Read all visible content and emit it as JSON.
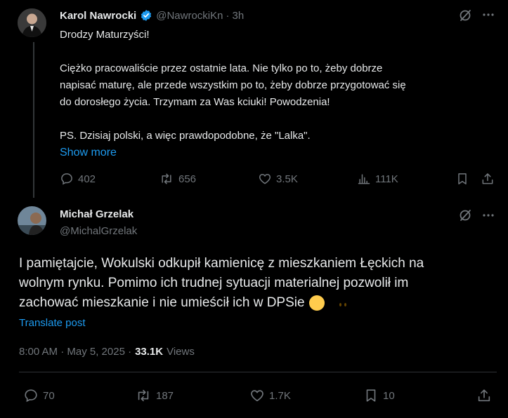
{
  "parent": {
    "author_name": "Karol Nawrocki",
    "handle": "@NawrockiKn",
    "separator": "·",
    "time": "3h",
    "lines": [
      "Drodzy Maturzyści!",
      "Ciężko pracowaliście przez ostatnie lata. Nie tylko po to, żeby dobrze",
      "napisać maturę, ale przede wszystkim po to, żeby dobrze przygotować się",
      "do dorosłego życia. Trzymam za Was kciuki! Powodzenia!",
      "PS. Dzisiaj polski, a więc prawdopodobne, że \"Lalka\"."
    ],
    "show_more": "Show more",
    "replies": "402",
    "reposts": "656",
    "likes": "3.5K",
    "views": "111K"
  },
  "reply": {
    "author_name": "Michał Grzelak",
    "handle": "@MichalGrzelak",
    "lines": [
      "I pamiętajcie, Wokulski odkupił kamienicę z mieszkaniem Łęckich na",
      "wolnym rynku. Pomimo ich trudnej sytuacji materialnej pozwolił im",
      "zachować mieszkanie i nie umieścił ich w DPSie"
    ],
    "emoji": "😶",
    "translate": "Translate post",
    "timestamp": "8:00 AM · May 5, 2025 ·",
    "views_count": "33.1K",
    "views_label": "Views",
    "replies": "70",
    "reposts": "187",
    "likes": "1.7K",
    "bookmarks": "10"
  },
  "colors": {
    "background": "#000000",
    "text": "#e7e9ea",
    "muted": "#71767b",
    "accent": "#1d9bf0",
    "divider": "#2f3336",
    "thread_line": "#333639"
  }
}
